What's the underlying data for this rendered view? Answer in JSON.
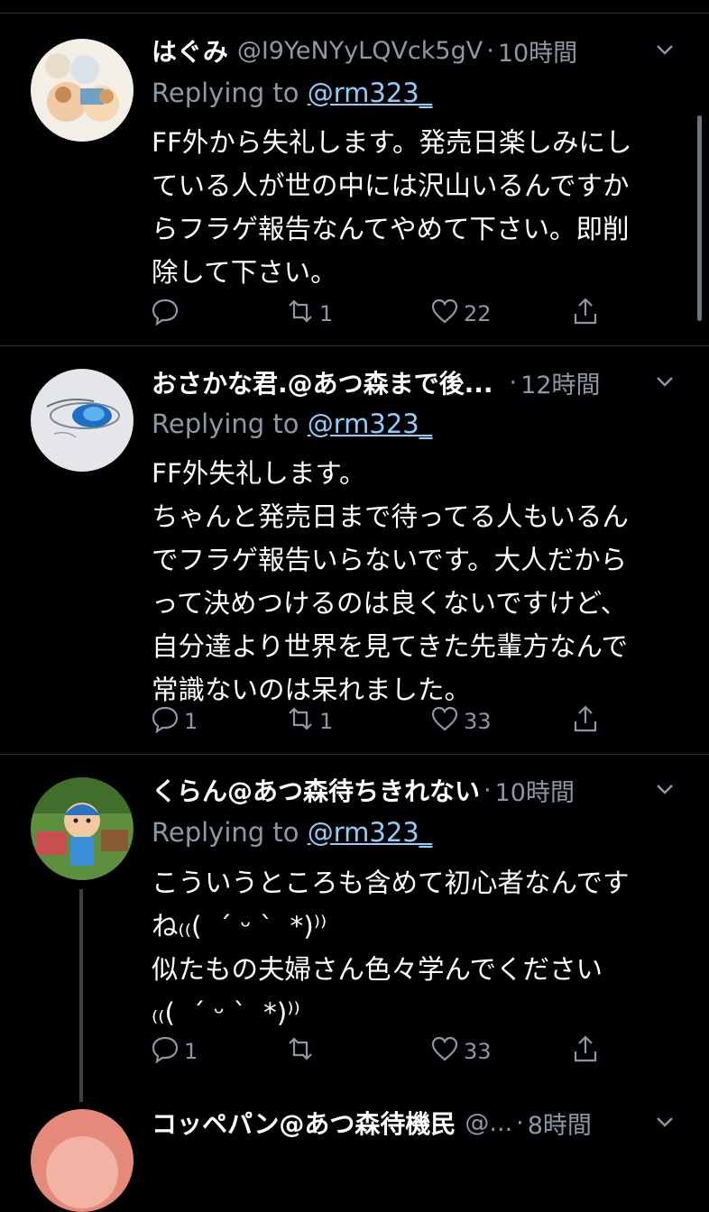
{
  "tweets": [
    {
      "name": "はぐみ",
      "handle": "@I9YeNYyLQVck5gV",
      "time": "10時間",
      "replying_prefix": "Replying to ",
      "replying_to": "@rm323_",
      "body": "FF外から失礼します。発売日楽しみにし\nている人が世の中には沢山いるんですか\nらフラゲ報告なんてやめて下さい。即削\n除して下さい。",
      "replies": "",
      "retweets": "1",
      "likes": "22"
    },
    {
      "name": "おさかな君.@あつ森まで後...",
      "handle": "",
      "time": "12時間",
      "replying_prefix": "Replying to ",
      "replying_to": "@rm323_",
      "body": "FF外失礼します。\nちゃんと発売日まで待ってる人もいるん\nでフラゲ報告いらないです。大人だから\nって決めつけるのは良くないですけど、\n自分達より世界を見てきた先輩方なんで\n常識ないのは呆れました。",
      "replies": "1",
      "retweets": "1",
      "likes": "33"
    },
    {
      "name": "くらん@あつ森待ちきれない",
      "handle": "",
      "time": "10時間",
      "replying_prefix": "Replying to ",
      "replying_to": "@rm323_",
      "body": "こういうところも含めて初心者なんです\nね₍₍(  ´ ᵕ `  *)⁾⁾\n似たもの夫婦さん色々学んでください\n₍₍(  ´ ᵕ `  *)⁾⁾",
      "replies": "1",
      "retweets": "",
      "likes": "33"
    },
    {
      "name": "コッペパン@あつ森待機民",
      "handle": "@...",
      "time": "8時間"
    }
  ],
  "icons": {
    "reply": "reply-icon",
    "retweet": "retweet-icon",
    "like": "like-icon",
    "share": "share-icon",
    "more": "chevron-down-icon"
  },
  "colors": {
    "background": "#000000",
    "secondary_text": "#8b98a5",
    "mention": "#8ecdf8",
    "separator": "#2f3336"
  }
}
